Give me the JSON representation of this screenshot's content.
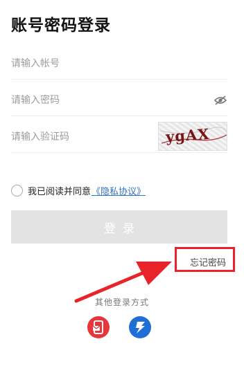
{
  "header": {
    "title": "账号密码登录"
  },
  "form": {
    "account_placeholder": "请输入帐号",
    "password_placeholder": "请输入密码",
    "captcha_placeholder": "请输入验证码",
    "captcha_text": "ygAX",
    "password_toggle_icon": "eye-slash-icon"
  },
  "agreement": {
    "checked": false,
    "text": "我已阅读并同意",
    "link_label": "《隐私协议》"
  },
  "actions": {
    "login_label": "登录",
    "forgot_label": "忘记密码"
  },
  "other_login": {
    "label": "其他登录方式",
    "providers": [
      {
        "icon": "sms-icon",
        "color": "#e8353b"
      },
      {
        "icon": "feishu-icon",
        "color": "#1f6ed6"
      }
    ]
  },
  "colors": {
    "accent_link": "#2e73c9",
    "annotation_red": "#e8232a",
    "button_disabled": "#e3e3e3"
  }
}
